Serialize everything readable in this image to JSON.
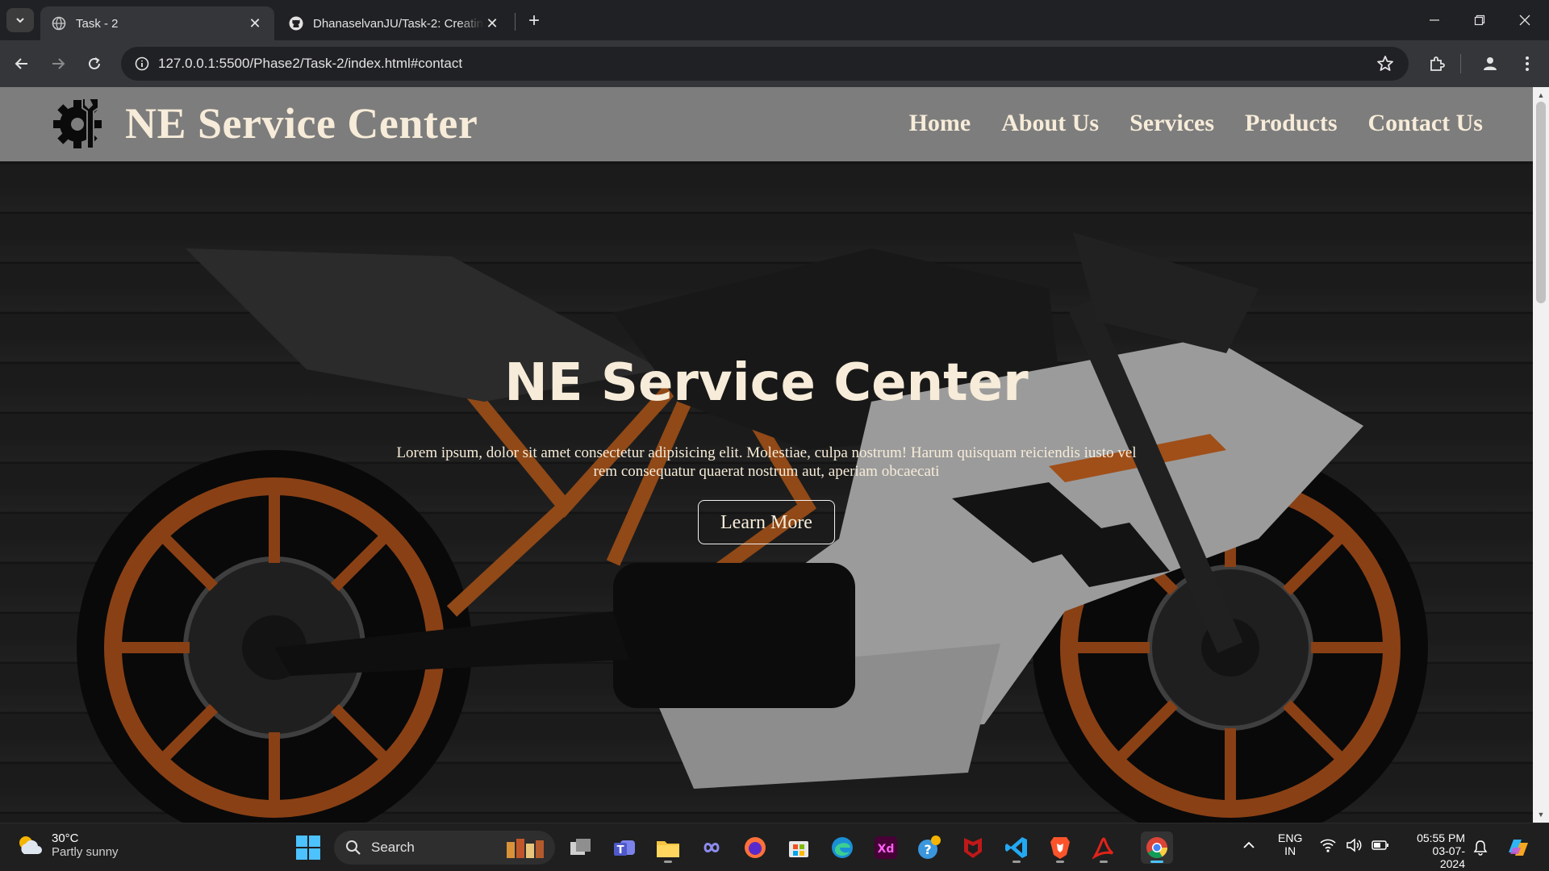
{
  "browser": {
    "tabs": [
      {
        "title": "Task - 2",
        "active": true,
        "icon": "globe-icon"
      },
      {
        "title": "DhanaselvanJU/Task-2: Creating",
        "active": false,
        "icon": "github-icon"
      }
    ],
    "address": "127.0.0.1:5500/Phase2/Task-2/index.html#contact"
  },
  "site": {
    "brand": "NE Service Center",
    "nav": [
      "Home",
      "About Us",
      "Services",
      "Products",
      "Contact Us"
    ],
    "hero": {
      "title": "NE Service Center",
      "text": "Lorem ipsum, dolor sit amet consectetur adipisicing elit. Molestiae, culpa nostrum! Harum quisquam reiciendis iusto vel rem consequatur quaerat nostrum aut, aperiam obcaecati",
      "button": "Learn More"
    },
    "colors": {
      "header": "#7d7d7d",
      "text": "#f7ecd9",
      "accent": "#e56a1a"
    }
  },
  "taskbar": {
    "weather_temp": "30°C",
    "weather_desc": "Partly sunny",
    "search": "Search",
    "lang_top": "ENG",
    "lang_bottom": "IN",
    "time": "05:55 PM",
    "date": "03-07-2024"
  }
}
